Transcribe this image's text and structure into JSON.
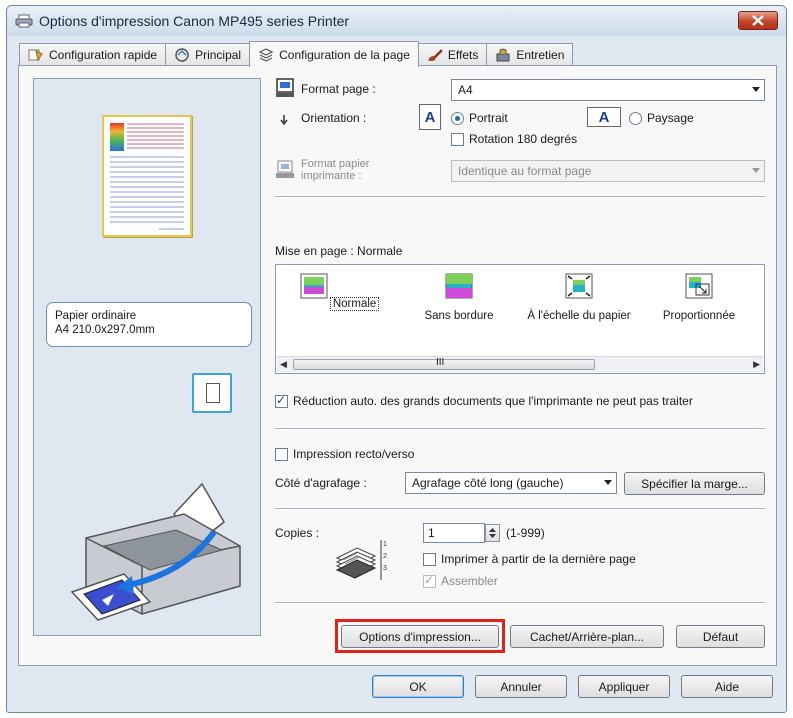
{
  "window": {
    "title": "Options d'impression Canon MP495 series Printer"
  },
  "tabs": [
    {
      "label": "Configuration rapide"
    },
    {
      "label": "Principal"
    },
    {
      "label": "Configuration de la page",
      "active": true
    },
    {
      "label": "Effets"
    },
    {
      "label": "Entretien"
    }
  ],
  "preview": {
    "media_line1": "Papier ordinaire",
    "media_line2": "A4 210.0x297.0mm"
  },
  "page_setup": {
    "format_label": "Format page :",
    "format_value": "A4",
    "orientation_label": "Orientation :",
    "portrait": "Portrait",
    "landscape": "Paysage",
    "orientation_selected": "Portrait",
    "rotate_label": "Rotation 180 degrés",
    "rotate_checked": false,
    "paper_size_label_1": "Format papier",
    "paper_size_label_2": "imprimante :",
    "paper_size_value": "Identique au format page"
  },
  "layout": {
    "label": "Mise en page : Normale",
    "items": [
      {
        "label": "Normale",
        "selected": true
      },
      {
        "label": "Sans bordure"
      },
      {
        "label": "À l'échelle du papier"
      },
      {
        "label": "Proportionnée"
      }
    ],
    "scroll_grip": "III",
    "auto_reduce_label": "Réduction auto. des grands documents que l'imprimante ne peut pas traiter",
    "auto_reduce_checked": true
  },
  "duplex": {
    "label": "Impression recto/verso",
    "checked": false,
    "stapling_label": "Côté d'agrafage :",
    "stapling_value": "Agrafage côté long (gauche)",
    "margin_button": "Spécifier la marge..."
  },
  "copies": {
    "label": "Copies :",
    "value": "1",
    "range": "(1-999)",
    "reverse_label": "Imprimer à partir de la dernière page",
    "reverse_checked": false,
    "collate_label": "Assembler",
    "collate_checked": true
  },
  "buttons": {
    "print_options": "Options d'impression...",
    "stamp_background": "Cachet/Arrière-plan...",
    "defaults": "Défaut",
    "ok": "OK",
    "cancel": "Annuler",
    "apply": "Appliquer",
    "help": "Aide"
  },
  "colors": {
    "highlight": "#e2231a",
    "selected_radio": "#1e6ac4"
  }
}
